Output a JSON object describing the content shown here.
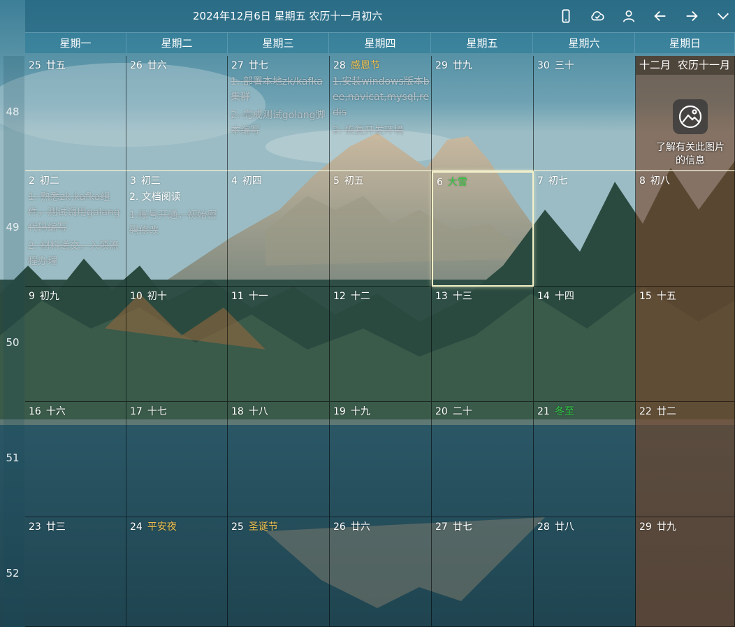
{
  "header": {
    "title": "2024年12月6日 星期五 农历十一月初六",
    "icons": [
      "phone-icon",
      "cloud-check-icon",
      "user-icon",
      "arrow-left-icon",
      "arrow-right-icon",
      "chevron-down-icon"
    ]
  },
  "weekdays": [
    "星期一",
    "星期二",
    "星期三",
    "星期四",
    "星期五",
    "星期六",
    "星期日"
  ],
  "weeks": [
    {
      "number": "48",
      "days": [
        {
          "day": "25",
          "lunar": "廿五",
          "events": []
        },
        {
          "day": "26",
          "lunar": "廿六",
          "events": []
        },
        {
          "day": "27",
          "lunar": "廿七",
          "events": [
            {
              "text": "1. 部署本地zk/kafka集群",
              "done": true
            },
            {
              "text": "2. 完成测试golang脚本编写",
              "done": true
            }
          ]
        },
        {
          "day": "28",
          "lunar": "感恩节",
          "lunar_type": "holiday",
          "events": [
            {
              "text": "1.安装windows版本bee,navicat,mysql,redis",
              "done": true
            },
            {
              "text": "2. 恢复开发环境",
              "done": true
            }
          ]
        },
        {
          "day": "29",
          "lunar": "廿九",
          "events": []
        },
        {
          "day": "30",
          "lunar": "三十",
          "events": []
        },
        {
          "day": "",
          "lunar": "",
          "month_header": [
            "十二月",
            "农历十一月"
          ],
          "events": []
        }
      ]
    },
    {
      "number": "49",
      "days": [
        {
          "day": "2",
          "lunar": "初二",
          "events": [
            {
              "text": "1. 熟悉zk,kafka组件，测试调用golang代码编写",
              "done": true
            },
            {
              "text": "2. 材料递交，入项流程办理",
              "done": true
            }
          ]
        },
        {
          "day": "3",
          "lunar": "初三",
          "events": [
            {
              "text": "2. 文档阅读",
              "done": false
            },
            {
              "text": "1.账号开通，初始密码修改",
              "done": true
            }
          ]
        },
        {
          "day": "4",
          "lunar": "初四",
          "events": []
        },
        {
          "day": "5",
          "lunar": "初五",
          "events": []
        },
        {
          "day": "6",
          "lunar": "大雪",
          "lunar_type": "term",
          "today": true,
          "events": []
        },
        {
          "day": "7",
          "lunar": "初七",
          "events": []
        },
        {
          "day": "8",
          "lunar": "初八",
          "events": []
        }
      ]
    },
    {
      "number": "50",
      "days": [
        {
          "day": "9",
          "lunar": "初九",
          "events": []
        },
        {
          "day": "10",
          "lunar": "初十",
          "events": []
        },
        {
          "day": "11",
          "lunar": "十一",
          "events": []
        },
        {
          "day": "12",
          "lunar": "十二",
          "events": []
        },
        {
          "day": "13",
          "lunar": "十三",
          "events": []
        },
        {
          "day": "14",
          "lunar": "十四",
          "events": []
        },
        {
          "day": "15",
          "lunar": "十五",
          "events": []
        }
      ]
    },
    {
      "number": "51",
      "days": [
        {
          "day": "16",
          "lunar": "十六",
          "events": []
        },
        {
          "day": "17",
          "lunar": "十七",
          "events": []
        },
        {
          "day": "18",
          "lunar": "十八",
          "events": []
        },
        {
          "day": "19",
          "lunar": "十九",
          "events": []
        },
        {
          "day": "20",
          "lunar": "二十",
          "events": []
        },
        {
          "day": "21",
          "lunar": "冬至",
          "lunar_type": "term",
          "events": []
        },
        {
          "day": "22",
          "lunar": "廿二",
          "events": []
        }
      ]
    },
    {
      "number": "52",
      "days": [
        {
          "day": "23",
          "lunar": "廿三",
          "events": []
        },
        {
          "day": "24",
          "lunar": "平安夜",
          "lunar_type": "holiday",
          "events": []
        },
        {
          "day": "25",
          "lunar": "圣诞节",
          "lunar_type": "holiday",
          "events": []
        },
        {
          "day": "26",
          "lunar": "廿六",
          "events": []
        },
        {
          "day": "27",
          "lunar": "廿七",
          "events": []
        },
        {
          "day": "28",
          "lunar": "廿八",
          "events": []
        },
        {
          "day": "29",
          "lunar": "廿九",
          "events": []
        }
      ]
    }
  ],
  "image_info": {
    "label": "了解有关此图片的信息",
    "icon": "camera-icon"
  },
  "colors": {
    "holiday": "#f2c14e",
    "solar_term": "#2ecc40",
    "today_border": "#f2f0c8",
    "sunday_tint": "#784628"
  }
}
